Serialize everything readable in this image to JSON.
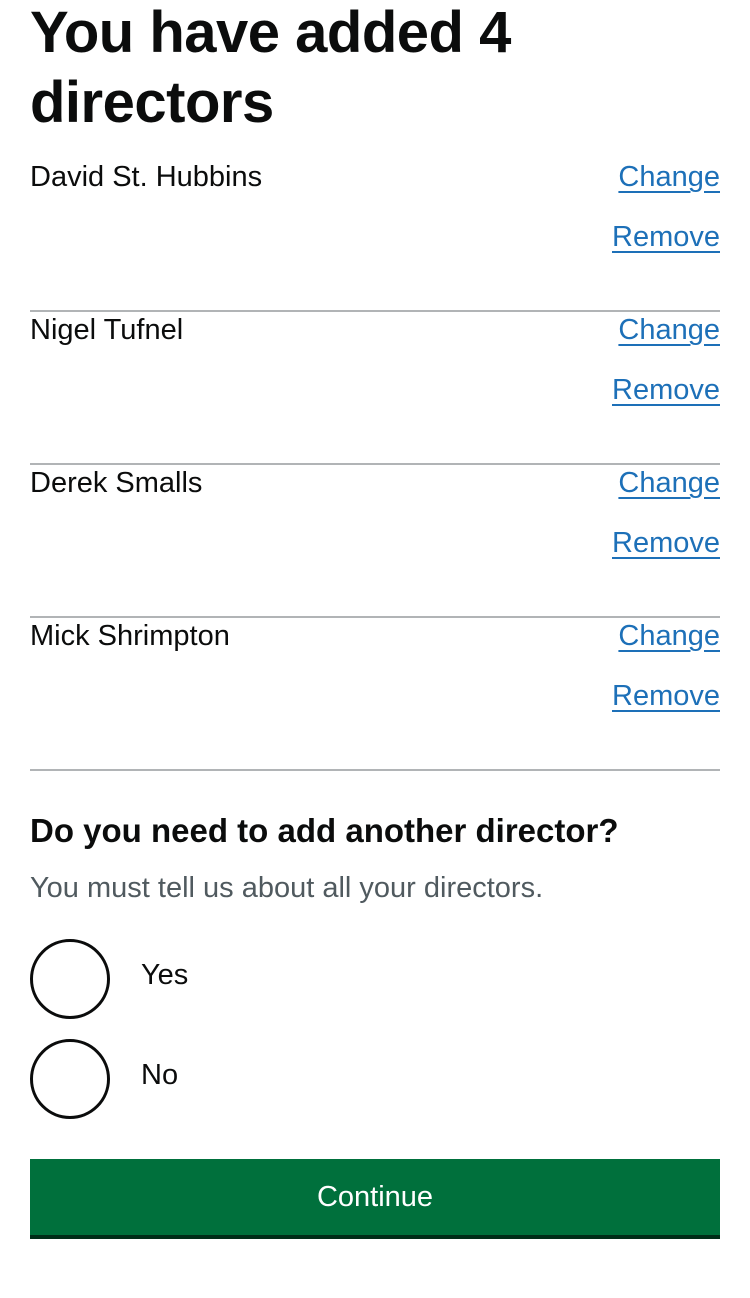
{
  "page": {
    "title": "You have added 4 directors"
  },
  "directors": [
    {
      "name": "David St. Hubbins",
      "change_label": "Change",
      "remove_label": "Remove"
    },
    {
      "name": "Nigel Tufnel",
      "change_label": "Change",
      "remove_label": "Remove"
    },
    {
      "name": "Derek Smalls",
      "change_label": "Change",
      "remove_label": "Remove"
    },
    {
      "name": "Mick Shrimpton",
      "change_label": "Change",
      "remove_label": "Remove"
    }
  ],
  "question": {
    "label": "Do you need to add another director?",
    "hint": "You must tell us about all your directors.",
    "options": [
      {
        "label": "Yes",
        "selected": false
      },
      {
        "label": "No",
        "selected": false
      }
    ]
  },
  "actions": {
    "continue_label": "Continue"
  },
  "colors": {
    "text": "#0b0c0c",
    "link": "#1d70b8",
    "hint": "#505a5f",
    "border": "#b1b4b6",
    "button": "#00703c",
    "button_shadow": "#002d18"
  }
}
